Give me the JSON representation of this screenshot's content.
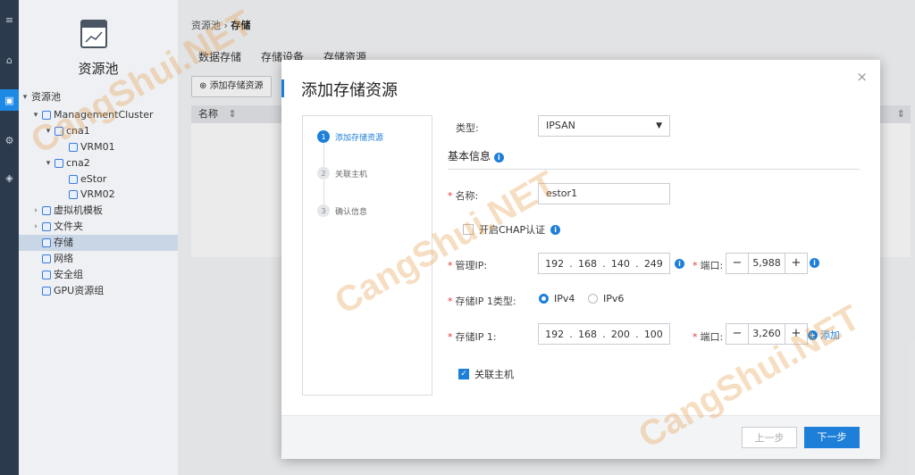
{
  "rail": {
    "icons": [
      "menu-icon",
      "home-icon",
      "resource-icon",
      "settings-icon",
      "monitor-icon"
    ]
  },
  "sidebar": {
    "title": "资源池",
    "tree": [
      {
        "label": "资源池",
        "level": 0,
        "expanded": true,
        "icon": "folder-icon"
      },
      {
        "label": "ManagementCluster",
        "level": 1,
        "expanded": true,
        "icon": "cluster-icon"
      },
      {
        "label": "cna1",
        "level": 2,
        "expanded": true,
        "icon": "host-icon"
      },
      {
        "label": "VRM01",
        "level": 3,
        "icon": "vm-icon"
      },
      {
        "label": "cna2",
        "level": 2,
        "expanded": true,
        "icon": "host-icon"
      },
      {
        "label": "eStor",
        "level": 3,
        "icon": "vm-icon"
      },
      {
        "label": "VRM02",
        "level": 3,
        "icon": "vm-icon"
      },
      {
        "label": "虚拟机模板",
        "level": 1,
        "expanded": false,
        "icon": "template-icon"
      },
      {
        "label": "文件夹",
        "level": 1,
        "expanded": false,
        "icon": "folder-icon"
      },
      {
        "label": "存储",
        "level": 1,
        "selected": true,
        "icon": "storage-icon"
      },
      {
        "label": "网络",
        "level": 1,
        "icon": "network-icon"
      },
      {
        "label": "安全组",
        "level": 1,
        "icon": "security-icon"
      },
      {
        "label": "GPU资源组",
        "level": 1,
        "icon": "gpu-icon"
      }
    ]
  },
  "main": {
    "breadcrumb": {
      "root": "资源池",
      "sep": "›",
      "current": "存储"
    },
    "tabs": [
      "数据存储",
      "存储设备",
      "存储资源"
    ],
    "toolbar": {
      "add_label": "添加存储资源"
    },
    "table": {
      "col_name": "名称"
    }
  },
  "modal": {
    "title": "添加存储资源",
    "close": "×",
    "steps": [
      {
        "num": "1",
        "label": "添加存储资源"
      },
      {
        "num": "2",
        "label": "关联主机"
      },
      {
        "num": "3",
        "label": "确认信息"
      }
    ],
    "form": {
      "type_label": "类型:",
      "type_value": "IPSAN",
      "section_title": "基本信息",
      "name_label": "名称:",
      "name_value": "estor1",
      "chap_label": "开启CHAP认证",
      "mgmt_ip_label": "管理IP:",
      "mgmt_ip": [
        "192",
        "168",
        "140",
        "249"
      ],
      "port_label": "端口:",
      "mgmt_port": "5,988",
      "ip_type_label": "存储IP 1类型:",
      "ipv4": "IPv4",
      "ipv6": "IPv6",
      "storage_ip_label": "存储IP 1:",
      "storage_ip": [
        "192",
        "168",
        "200",
        "100"
      ],
      "storage_port": "3,260",
      "add_link": "添加",
      "assoc_host_label": "关联主机"
    },
    "footer": {
      "prev": "上一步",
      "next": "下一步"
    }
  },
  "watermark": "CangShui.NET",
  "colors": {
    "accent": "#1e7fd9",
    "required": "#e53935",
    "rail": "#2c3a4e"
  }
}
